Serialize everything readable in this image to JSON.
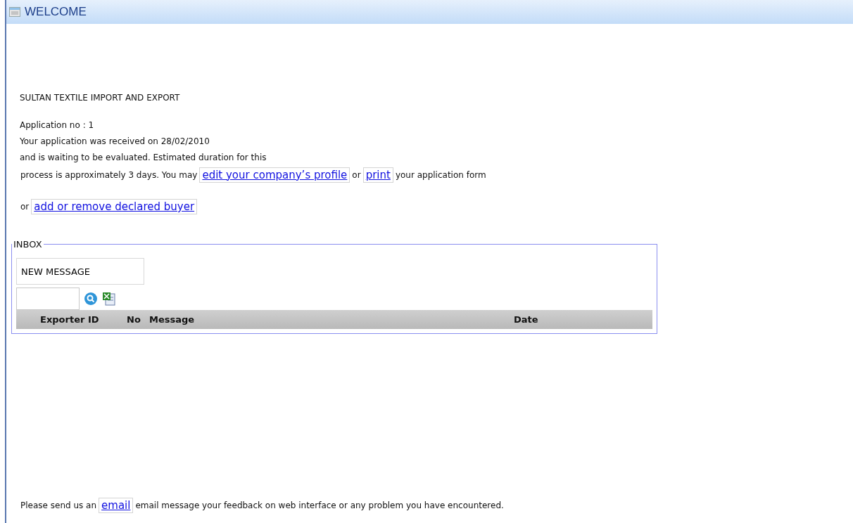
{
  "header": {
    "title": "WELCOME"
  },
  "company": "SULTAN TEXTILE IMPORT AND EXPORT",
  "lines": [
    "Application no : 1",
    "Your application was received on 28/02/2010",
    "and is waiting to be evaluated. Estimated duration for this"
  ],
  "actions": [
    [
      {
        "kind": "text",
        "text": "process is approximately 3 days. You may"
      },
      {
        "kind": "link",
        "text": "edit your company’s profile"
      },
      {
        "kind": "text",
        "text": "or"
      },
      {
        "kind": "link",
        "text": "print"
      },
      {
        "kind": "text",
        "text": "your application form"
      }
    ],
    [
      {
        "kind": "text",
        "text": "or"
      },
      {
        "kind": "link",
        "text": "add or remove declared buyer"
      }
    ]
  ],
  "inbox": {
    "legend": "INBOX",
    "new_message": "NEW MESSAGE",
    "columns": [
      "Exporter ID",
      "No",
      "Message",
      "Date"
    ]
  },
  "footer": [
    {
      "kind": "text",
      "text": "Please send us an"
    },
    {
      "kind": "link",
      "text": "email"
    },
    {
      "kind": "text",
      "text": "email message your feedback on web interface or any problem you have encountered."
    }
  ]
}
